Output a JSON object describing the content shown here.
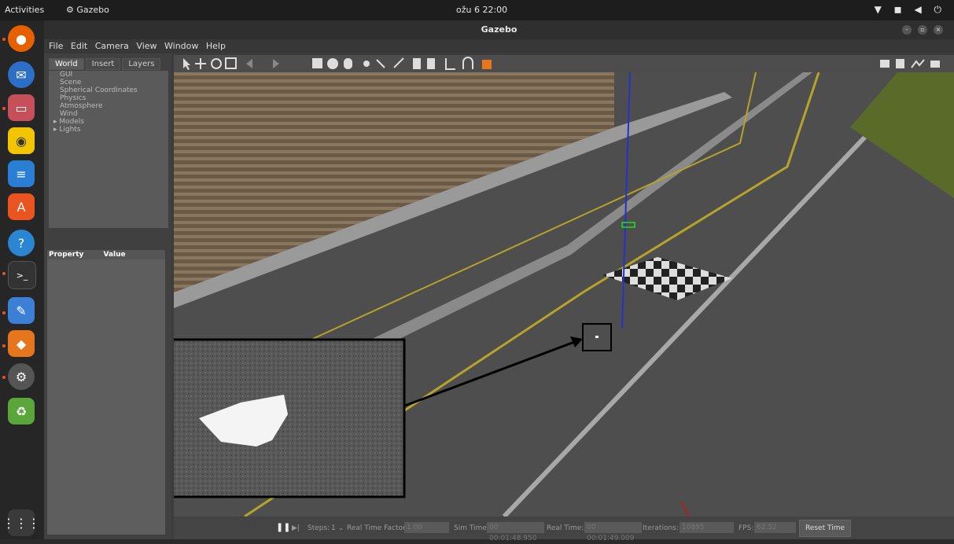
{
  "topbar": {
    "activities": "Activities",
    "app_name": "Gazebo",
    "clock": "ožu 6  22:00"
  },
  "window": {
    "title": "Gazebo"
  },
  "menu": [
    "File",
    "Edit",
    "Camera",
    "View",
    "Window",
    "Help"
  ],
  "left_panel": {
    "tabs": [
      "World",
      "Insert",
      "Layers"
    ],
    "tree": [
      "GUI",
      "Scene",
      "Spherical Coordinates",
      "Physics",
      "Atmosphere",
      "Wind"
    ],
    "expandable": [
      "Models",
      "Lights"
    ],
    "property_col": "Property",
    "value_col": "Value"
  },
  "bottom": {
    "steps_label": "Steps:",
    "steps_value": "1",
    "rtf_label": "Real Time Factor:",
    "rtf_value": "1.00",
    "sim_time_label": "Sim Time:",
    "sim_time_value": "00 00:01:48.950",
    "real_time_label": "Real Time:",
    "real_time_value": "00 00:01:49.009",
    "iterations_label": "Iterations:",
    "iterations_value": "10895",
    "fps_label": "FPS:",
    "fps_value": "62.52",
    "reset_label": "Reset Time"
  },
  "colors": {
    "accent": "#e95420",
    "track": "#4a4a4a",
    "grass": "#5a6a28",
    "lane_yellow": "#b5a32a"
  }
}
